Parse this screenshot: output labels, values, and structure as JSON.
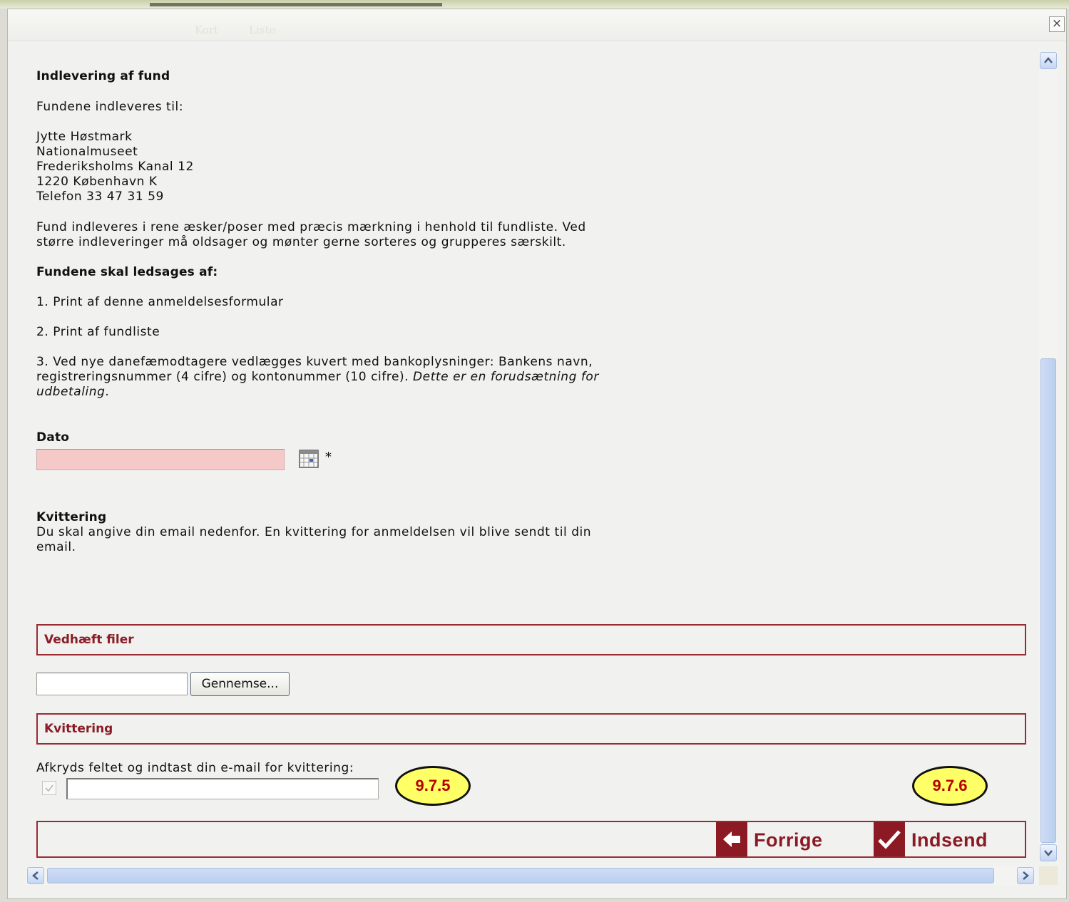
{
  "background_tabs": [
    "Kort",
    "Liste"
  ],
  "close_label": "×",
  "content": {
    "heading_delivery": "Indlevering af fund",
    "delivered_to": "Fundene indleveres til:",
    "address": [
      "Jytte Høstmark",
      "Nationalmuseet",
      "Frederiksholms Kanal 12",
      "1220 København K",
      "Telefon 33 47 31 59"
    ],
    "packaging": [
      "Fund indleveres i rene æsker/poser med præcis mærkning i henhold til fundliste. Ved",
      "større indleveringer må oldsager og mønter gerne sorteres og grupperes særskilt."
    ],
    "accompany_heading": "Fundene skal ledsages af:",
    "item1": "1. Print af denne anmeldelsesformular",
    "item2": "2. Print af fundliste",
    "item3_line1": "3. Ved nye danefæmodtagere vedlægges kuvert med bankoplysninger: Bankens navn,",
    "item3_line2": "registreringsnummer (4 cifre) og kontonummer (10 cifre). ",
    "item3_italic_a": "Dette er en forudsætning for",
    "item3_italic_b": "udbetaling",
    "item3_end": "."
  },
  "date": {
    "label": "Dato",
    "value": "",
    "required_mark": "*",
    "icon": "calendar-icon"
  },
  "receipt_info": {
    "heading": "Kvittering",
    "text": [
      "Du skal angive din email nedenfor. En kvittering for anmeldelsen vil blive sendt til din",
      "email."
    ]
  },
  "sections": {
    "attach_files": "Vedhæft filer",
    "receipt": "Kvittering"
  },
  "file_upload": {
    "browse_label": "Gennemse..."
  },
  "receipt_form": {
    "prompt": "Afkryds feltet og indtast din e-mail for kvittering:",
    "email_value": ""
  },
  "callouts": [
    "9.7.5",
    "9.7.6"
  ],
  "navigation": {
    "back_label": "Forrige",
    "submit_label": "Indsend"
  },
  "colors": {
    "accent": "#8b1a24",
    "date_error_bg": "#f6c9c9",
    "callout_bg": "#ffff66",
    "scrollbar": "#c4d6f3"
  }
}
